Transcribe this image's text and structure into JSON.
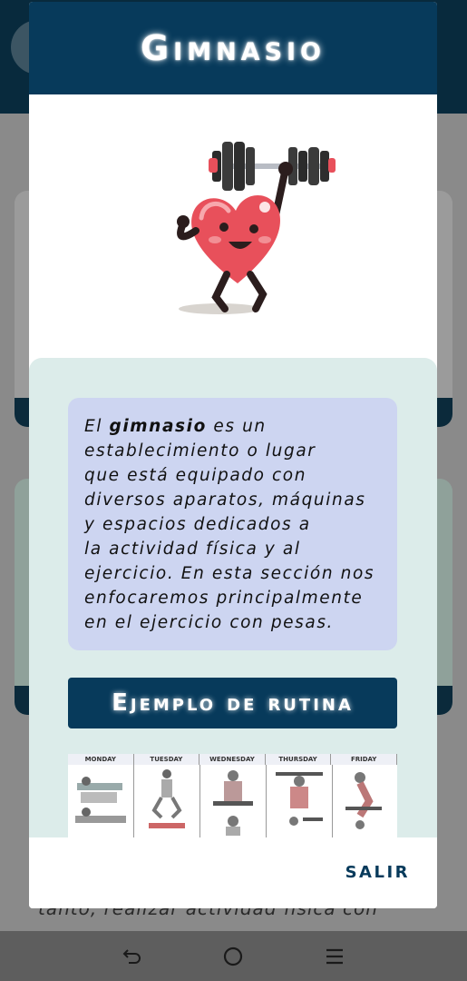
{
  "background": {
    "partial_text": "tanto, realizar actividad física con"
  },
  "dialog": {
    "title": "Gimnasio",
    "description": {
      "prefix": "El ",
      "bold": "gimnasio",
      "lines": [
        " es un",
        "establecimiento o lugar",
        "que está equipado con",
        "diversos aparatos, máquinas",
        "y espacios dedicados a",
        "la actividad física y al",
        "ejercicio. En esta sección nos",
        "enfocaremos principalmente",
        "en el ejercicio con pesas."
      ]
    },
    "routine_button": "Ejemplo de rutina",
    "routine_days": [
      "MONDAY",
      "TUESDAY",
      "WEDNESDAY",
      "THURSDAY",
      "FRIDAY"
    ],
    "exit_button": "SALIR"
  },
  "colors": {
    "header": "#073a5b",
    "panel": "#dcecea",
    "description_box": "#cdd5f1",
    "heart": "#e8505b"
  },
  "icons": {
    "nav_back": "back-arrow-icon",
    "nav_home": "home-circle-icon",
    "nav_recents": "recents-lines-icon"
  }
}
